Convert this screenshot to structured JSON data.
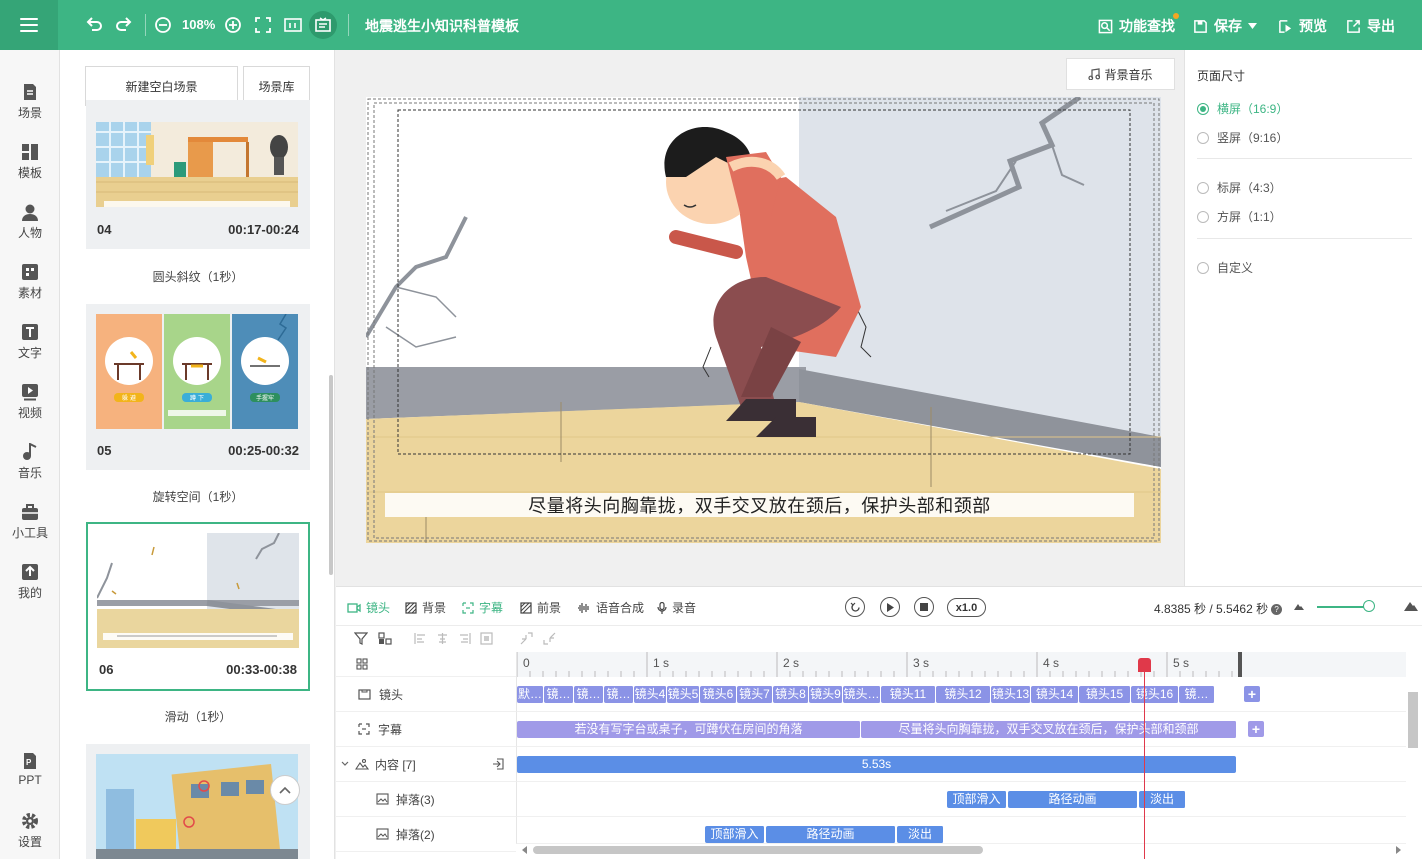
{
  "toolbar": {
    "zoom": "108%",
    "title": "地震逃生小知识科普模板",
    "find_label": "功能查找",
    "save_label": "保存",
    "preview_label": "预览",
    "export_label": "导出"
  },
  "sidebar": {
    "items": [
      {
        "label": "场景",
        "icon": "scene-icon"
      },
      {
        "label": "模板",
        "icon": "template-icon"
      },
      {
        "label": "人物",
        "icon": "person-icon"
      },
      {
        "label": "素材",
        "icon": "material-icon"
      },
      {
        "label": "文字",
        "icon": "text-icon"
      },
      {
        "label": "视频",
        "icon": "video-icon"
      },
      {
        "label": "音乐",
        "icon": "music-icon"
      },
      {
        "label": "小工具",
        "icon": "tools-icon"
      },
      {
        "label": "我的",
        "icon": "mine-icon"
      },
      {
        "label": "PPT",
        "icon": "ppt-icon"
      },
      {
        "label": "设置",
        "icon": "settings-icon"
      }
    ]
  },
  "scenes": {
    "new_blank": "新建空白场景",
    "library": "场景库",
    "cards": [
      {
        "num": "04",
        "time": "00:17-00:24",
        "transition": "圆头斜纹（1秒）"
      },
      {
        "num": "05",
        "time": "00:25-00:32",
        "transition": "旋转空间（1秒）"
      },
      {
        "num": "06",
        "time": "00:33-00:38",
        "transition": "滑动（1秒）"
      }
    ],
    "thumb_texts": {
      "s05_a": "躲 避",
      "s05_b": "蹲 下",
      "s05_c": "手握牢"
    }
  },
  "canvas": {
    "bgm_label": "背景音乐",
    "subtitle": "尽量将头向胸靠拢，双手交叉放在颈后，保护头部和颈部"
  },
  "props": {
    "heading": "页面尺寸",
    "options": [
      {
        "label": "横屏（16:9）",
        "selected": true
      },
      {
        "label": "竖屏（9:16）",
        "selected": false
      },
      {
        "label": "标屏（4:3）",
        "selected": false
      },
      {
        "label": "方屏（1:1）",
        "selected": false
      },
      {
        "label": "自定义",
        "selected": false
      }
    ]
  },
  "timeline": {
    "tabs": [
      "镜头",
      "背景",
      "字幕",
      "前景",
      "语音合成",
      "录音"
    ],
    "speed": "x1.0",
    "time_readout": "4.8385 秒 / 5.5462 秒",
    "playhead_seconds": 4.8385,
    "total_seconds": 5.5462,
    "ruler": [
      "0",
      "1 s",
      "2 s",
      "3 s",
      "4 s",
      "5 s"
    ],
    "tracks": {
      "lens": {
        "label": "镜头",
        "blocks": [
          "默…",
          "镜…",
          "镜…",
          "镜…",
          "镜头4",
          "镜头5",
          "镜头6",
          "镜头7",
          "镜头8",
          "镜头9",
          "镜头…",
          "镜头11",
          "镜头12",
          "镜头13",
          "镜头14",
          "镜头15",
          "镜头16",
          "镜…"
        ]
      },
      "subtitle": {
        "label": "字幕",
        "blocks": [
          "若没有写字台或桌子，可蹲伏在房间的角落",
          "尽量将头向胸靠拢，双手交叉放在颈后，保护头部和颈部"
        ]
      },
      "content": {
        "label": "内容 [7]",
        "duration": "5.53s"
      },
      "drop3": {
        "label": "掉落(3)",
        "blocks": [
          "顶部滑入",
          "路径动画",
          "淡出"
        ]
      },
      "drop2": {
        "label": "掉落(2)",
        "blocks": [
          "顶部滑入",
          "路径动画",
          "淡出"
        ]
      }
    }
  },
  "colors": {
    "accent": "#3db584",
    "lens": "#8b93e6",
    "content": "#5b8ee6",
    "playhead": "#e0394a"
  }
}
